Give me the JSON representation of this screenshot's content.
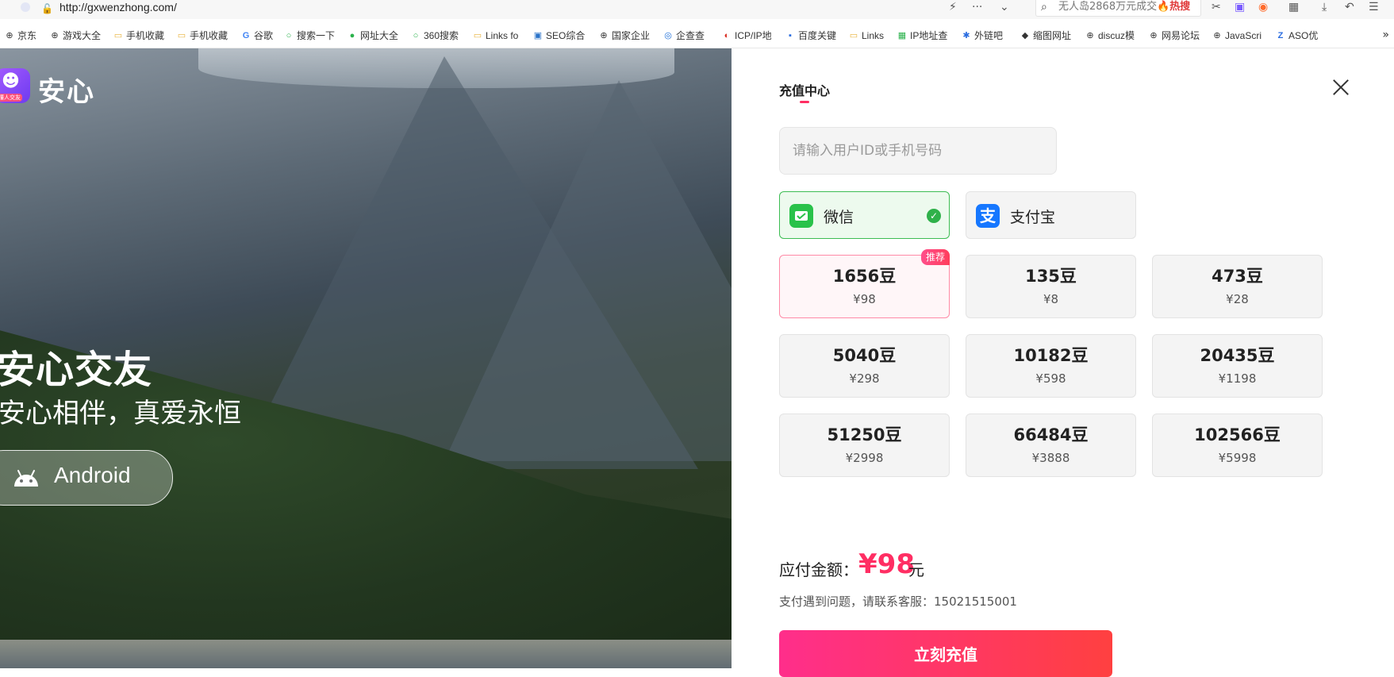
{
  "browser": {
    "url": "http://gxwenzhong.com/",
    "search_text": "无人岛2868万元成交",
    "search_hot": "🔥热搜"
  },
  "bookmarks": [
    {
      "label": "京东",
      "icon": "globe-icon"
    },
    {
      "label": "游戏大全",
      "icon": "globe-icon"
    },
    {
      "label": "手机收藏",
      "icon": "folder-icon"
    },
    {
      "label": "手机收藏",
      "icon": "folder-icon"
    },
    {
      "label": "谷歌",
      "icon": "google-icon"
    },
    {
      "label": "搜索一下",
      "icon": "search-engine-icon"
    },
    {
      "label": "网址大全",
      "icon": "site-icon"
    },
    {
      "label": "360搜索",
      "icon": "search-engine-icon"
    },
    {
      "label": "Links fo",
      "icon": "folder-icon"
    },
    {
      "label": "SEO综合",
      "icon": "site-icon"
    },
    {
      "label": "国家企业",
      "icon": "globe-icon"
    },
    {
      "label": "企查查",
      "icon": "site-icon"
    },
    {
      "label": "ICP/IP地",
      "icon": "site-icon"
    },
    {
      "label": "百度关键",
      "icon": "site-icon"
    },
    {
      "label": "Links",
      "icon": "folder-icon"
    },
    {
      "label": "IP地址查",
      "icon": "site-icon"
    },
    {
      "label": "外链吧",
      "icon": "paw-icon"
    },
    {
      "label": "缩图网址",
      "icon": "site-icon"
    },
    {
      "label": "discuz模",
      "icon": "globe-icon"
    },
    {
      "label": "网易论坛",
      "icon": "globe-icon"
    },
    {
      "label": "JavaScri",
      "icon": "globe-icon"
    },
    {
      "label": "ASO优",
      "icon": "site-icon"
    }
  ],
  "hero": {
    "logo_name": "安心",
    "logo_badge_text": "懂人交友",
    "title": "安心交友",
    "subtitle": "安心相伴，真爱永恒",
    "android_label": "Android"
  },
  "panel": {
    "title": "充值中心",
    "input_placeholder": "请输入用户ID或手机号码",
    "input_value": "",
    "payments": [
      {
        "label": "微信",
        "icon": "wechat-pay-icon",
        "selected": true
      },
      {
        "label": "支付宝",
        "icon": "alipay-icon",
        "selected": false
      }
    ],
    "packages": [
      {
        "beans": "1656豆",
        "price": "¥98",
        "tag": "推荐",
        "selected": true
      },
      {
        "beans": "135豆",
        "price": "¥8",
        "tag": "",
        "selected": false
      },
      {
        "beans": "473豆",
        "price": "¥28",
        "tag": "",
        "selected": false
      },
      {
        "beans": "5040豆",
        "price": "¥298",
        "tag": "",
        "selected": false
      },
      {
        "beans": "10182豆",
        "price": "¥598",
        "tag": "",
        "selected": false
      },
      {
        "beans": "20435豆",
        "price": "¥1198",
        "tag": "",
        "selected": false
      },
      {
        "beans": "51250豆",
        "price": "¥2998",
        "tag": "",
        "selected": false
      },
      {
        "beans": "66484豆",
        "price": "¥3888",
        "tag": "",
        "selected": false
      },
      {
        "beans": "102566豆",
        "price": "¥5998",
        "tag": "",
        "selected": false
      }
    ],
    "amount_label": "应付金额：",
    "amount_value": "¥98",
    "amount_unit": "元",
    "support_text": "支付遇到问题，请联系客服：15021515001",
    "submit_label": "立刻充值"
  },
  "colors": {
    "accent": "#ff2e63",
    "wechat_green": "#29c24a",
    "alipay_blue": "#1677ff"
  }
}
